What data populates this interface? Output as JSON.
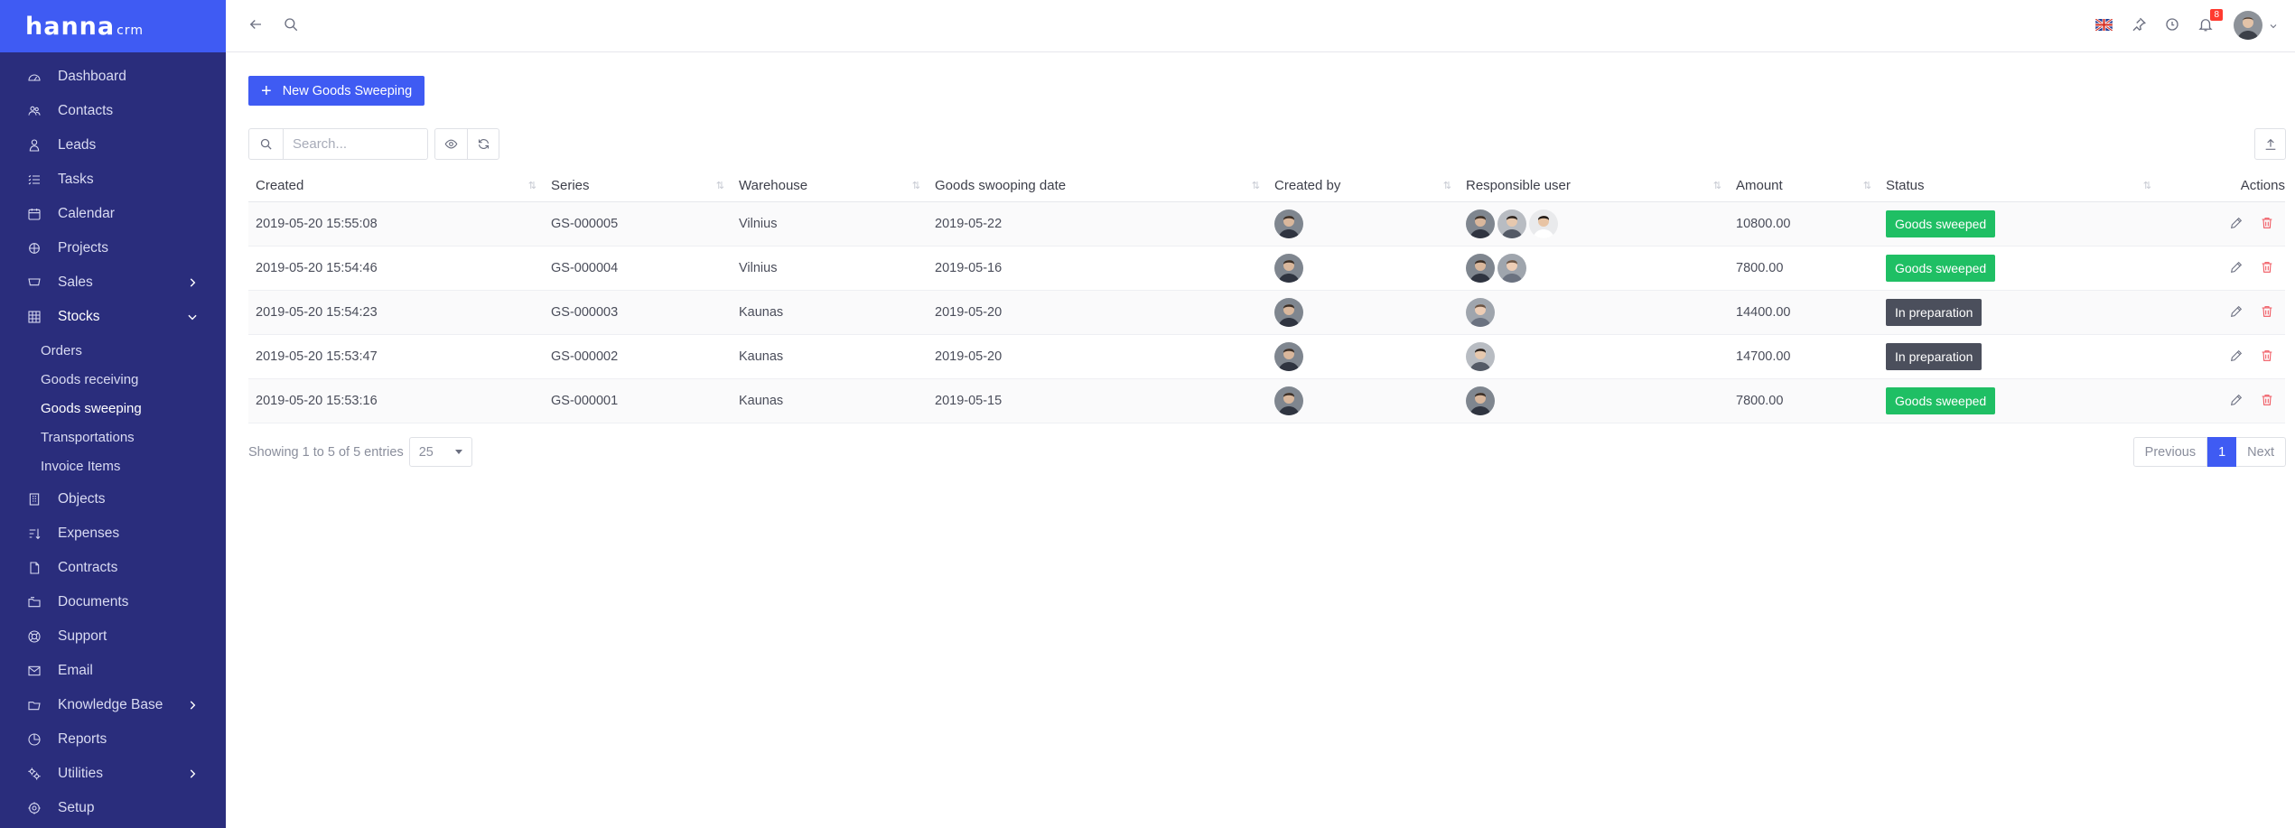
{
  "brand": {
    "name": "hanna",
    "suffix": "crm"
  },
  "sidebar": {
    "items": [
      {
        "label": "Dashboard",
        "icon": "dashboard-icon"
      },
      {
        "label": "Contacts",
        "icon": "contacts-icon"
      },
      {
        "label": "Leads",
        "icon": "leads-icon"
      },
      {
        "label": "Tasks",
        "icon": "tasks-icon"
      },
      {
        "label": "Calendar",
        "icon": "calendar-icon"
      },
      {
        "label": "Projects",
        "icon": "projects-icon"
      },
      {
        "label": "Sales",
        "icon": "sales-icon",
        "has_children": true
      },
      {
        "label": "Stocks",
        "icon": "stocks-icon",
        "expanded": true
      },
      {
        "label": "Objects",
        "icon": "objects-icon"
      },
      {
        "label": "Expenses",
        "icon": "expenses-icon"
      },
      {
        "label": "Contracts",
        "icon": "contracts-icon"
      },
      {
        "label": "Documents",
        "icon": "documents-icon"
      },
      {
        "label": "Support",
        "icon": "support-icon"
      },
      {
        "label": "Email",
        "icon": "email-icon"
      },
      {
        "label": "Knowledge Base",
        "icon": "knowledge-base-icon",
        "has_children": true
      },
      {
        "label": "Reports",
        "icon": "reports-icon"
      },
      {
        "label": "Utilities",
        "icon": "utilities-icon",
        "has_children": true
      },
      {
        "label": "Setup",
        "icon": "setup-icon"
      }
    ],
    "stocks_sub": [
      "Orders",
      "Goods receiving",
      "Goods sweeping",
      "Transportations",
      "Invoice Items"
    ],
    "active_sub": "Goods sweeping"
  },
  "topbar": {
    "notifications_count": "8"
  },
  "toolbar": {
    "new_button": "New Goods Sweeping",
    "search_placeholder": "Search..."
  },
  "table": {
    "columns": [
      "Created",
      "Series",
      "Warehouse",
      "Goods swooping date",
      "Created by",
      "Responsible user",
      "Amount",
      "Status",
      "Actions"
    ],
    "rows": [
      {
        "created": "2019-05-20 15:55:08",
        "series": "GS-000005",
        "warehouse": "Vilnius",
        "date": "2019-05-22",
        "amount": "10800.00",
        "status": "Goods sweeped",
        "status_color": "#1fbf64",
        "responsible": 3
      },
      {
        "created": "2019-05-20 15:54:46",
        "series": "GS-000004",
        "warehouse": "Vilnius",
        "date": "2019-05-16",
        "amount": "7800.00",
        "status": "Goods sweeped",
        "status_color": "#1fbf64",
        "responsible": 2
      },
      {
        "created": "2019-05-20 15:54:23",
        "series": "GS-000003",
        "warehouse": "Kaunas",
        "date": "2019-05-20",
        "amount": "14400.00",
        "status": "In preparation",
        "status_color": "#4b4f5c",
        "responsible": 1
      },
      {
        "created": "2019-05-20 15:53:47",
        "series": "GS-000002",
        "warehouse": "Kaunas",
        "date": "2019-05-20",
        "amount": "14700.00",
        "status": "In preparation",
        "status_color": "#4b4f5c",
        "responsible": 1
      },
      {
        "created": "2019-05-20 15:53:16",
        "series": "GS-000001",
        "warehouse": "Kaunas",
        "date": "2019-05-15",
        "amount": "7800.00",
        "status": "Goods sweeped",
        "status_color": "#1fbf64",
        "responsible": 1
      }
    ]
  },
  "footer": {
    "showing": "Showing 1 to 5 of 5 entries",
    "page_size": "25",
    "prev": "Previous",
    "current_page": "1",
    "next": "Next"
  },
  "colors": {
    "accent": "#3f5bf3",
    "sidebar": "#2a2d7c",
    "success": "#1fbf64",
    "dark": "#4b4f5c",
    "danger": "#f0565f"
  }
}
